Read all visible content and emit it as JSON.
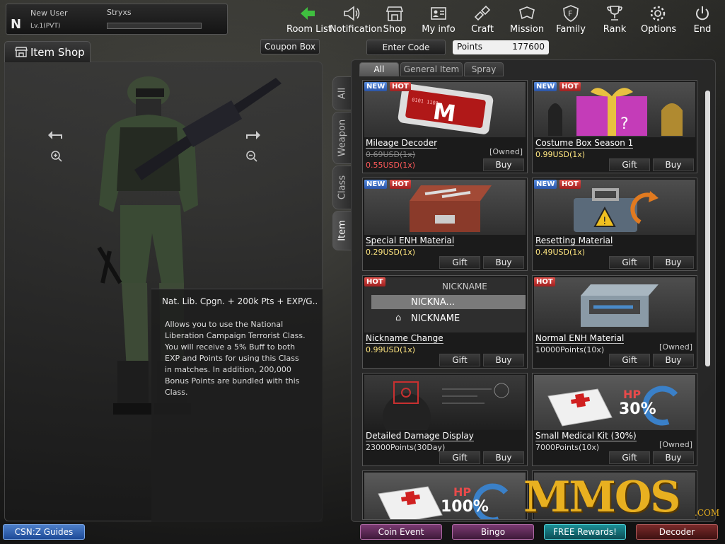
{
  "user": {
    "rank_letter": "N",
    "name": "New User",
    "level": "Lv.1(PVT)",
    "clan": "Stryxs",
    "exp_fraction": 0.0
  },
  "nav": [
    {
      "label": "Room List",
      "icon": "back-arrow-icon"
    },
    {
      "label": "Notification",
      "icon": "megaphone-icon"
    },
    {
      "label": "Shop",
      "icon": "shop-icon"
    },
    {
      "label": "My info",
      "icon": "id-card-icon"
    },
    {
      "label": "Craft",
      "icon": "craft-icon"
    },
    {
      "label": "Mission",
      "icon": "mission-icon"
    },
    {
      "label": "Family",
      "icon": "family-icon"
    },
    {
      "label": "Rank",
      "icon": "trophy-icon"
    },
    {
      "label": "Options",
      "icon": "gear-icon"
    },
    {
      "label": "End",
      "icon": "power-icon"
    }
  ],
  "left": {
    "tab_label": "Item Shop",
    "coupon_label": "Coupon Box",
    "desc_title": "Nat. Lib. Cpgn. + 200k Pts + EXP/G..",
    "desc_body": "Allows you to use the National Liberation Campaign Terrorist Class. You will receive a 5% Buff to both EXP and Points for using this Class in matches. In addition, 200,000 Bonus Points are bundled with this Class."
  },
  "vtabs": [
    "All",
    "Weapon",
    "Class",
    "Item"
  ],
  "right": {
    "enter_code": "Enter Code",
    "points_label": "Points",
    "points_value": "177600",
    "tabs": [
      "All",
      "General Item",
      "Spray"
    ]
  },
  "buttons": {
    "gift": "Gift",
    "buy": "Buy"
  },
  "badges": {
    "new": "NEW",
    "hot": "HOT"
  },
  "cards": [
    {
      "name": "Mileage Decoder",
      "old_price": "0.69USD(1x)",
      "sale_price": "0.55USD(1x)",
      "owned": "[Owned]",
      "new": true,
      "hot": true
    },
    {
      "name": "Costume Box Season 1",
      "price": "0.99USD(1x)",
      "new": true,
      "hot": true
    },
    {
      "name": "Special ENH Material",
      "price": "0.29USD(1x)",
      "new": true,
      "hot": true
    },
    {
      "name": "Resetting Material",
      "price": "0.49USD(1x)",
      "new": true,
      "hot": true
    },
    {
      "name": "Nickname Change",
      "price": "0.99USD(1x)",
      "hot": true,
      "nick_header": "NICKNAME",
      "nick_row1": "NICKNA...",
      "nick_row2": "NICKNAME"
    },
    {
      "name": "Normal ENH Material",
      "price": "10000Points(10x)",
      "owned": "[Owned]",
      "hot": true
    },
    {
      "name": "Detailed Damage Display",
      "price": "23000Points(30Day)"
    },
    {
      "name": "Small Medical Kit (30%)",
      "price": "7000Points(10x)",
      "owned": "[Owned]",
      "hp_label": "HP",
      "hp_value": "30%"
    },
    {
      "hp_label": "HP",
      "hp_value": "100%"
    }
  ],
  "bottom": {
    "guides": "CSN:Z Guides",
    "coin": "Coin Event",
    "bingo": "Bingo",
    "free": "FREE Rewards!",
    "decoder": "Decoder"
  },
  "watermark": {
    "text": "MMOS",
    "com": ".COM"
  },
  "colors": {
    "price": "#ffe680",
    "sale": "#ff5a5a",
    "new_badge": "#3a6ec8",
    "hot_badge": "#c83030"
  }
}
